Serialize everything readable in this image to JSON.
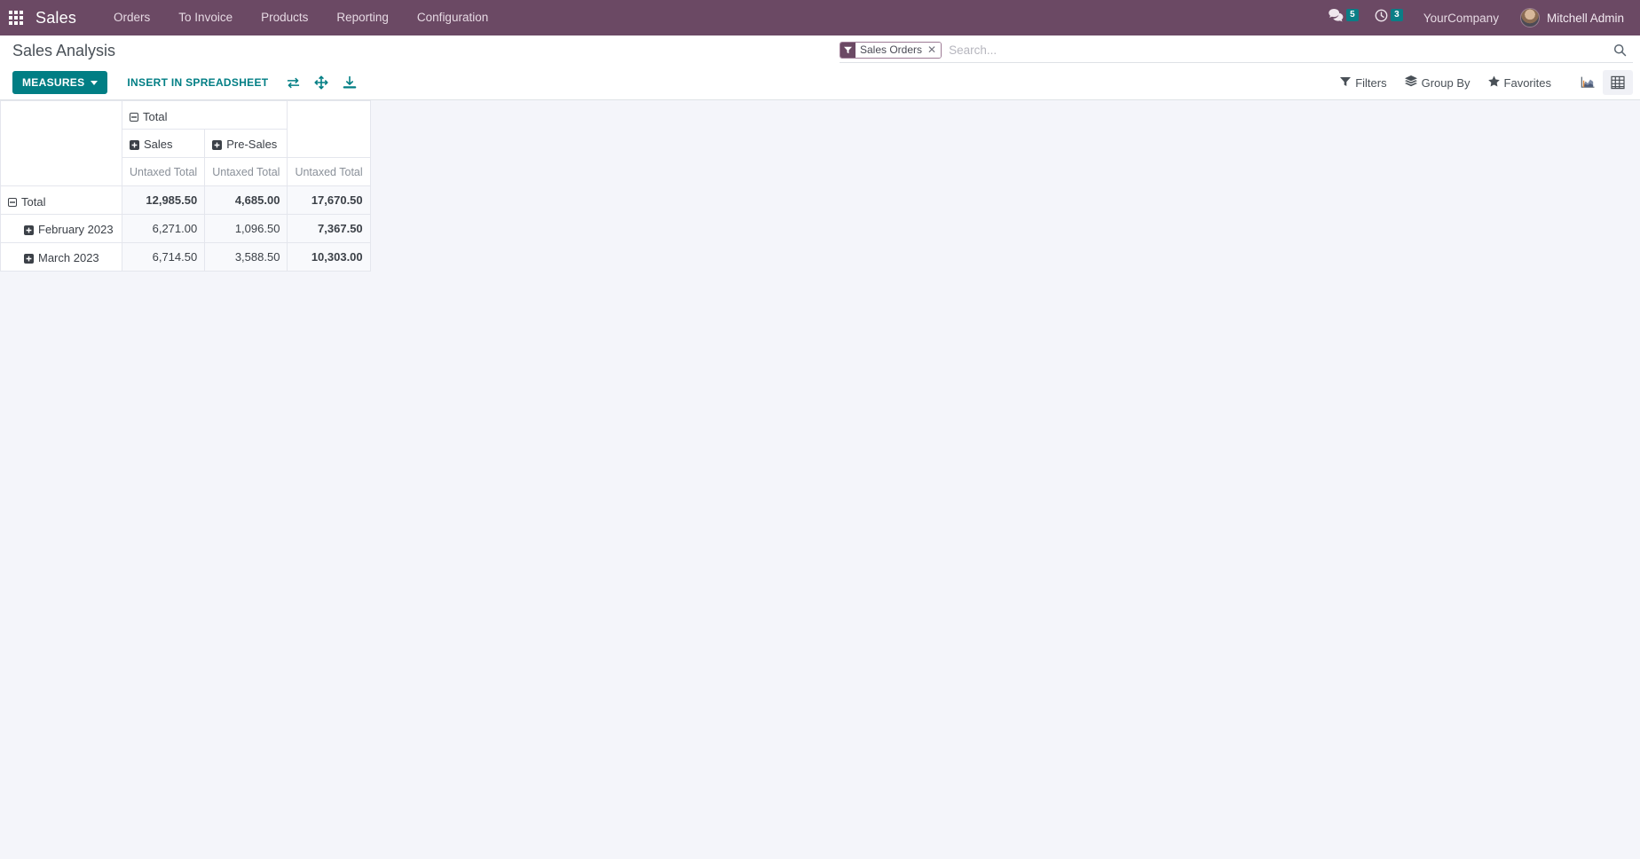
{
  "navbar": {
    "apps_icon": "apps-grid-icon",
    "brand": "Sales",
    "menu": [
      {
        "label": "Orders"
      },
      {
        "label": "To Invoice"
      },
      {
        "label": "Products"
      },
      {
        "label": "Reporting"
      },
      {
        "label": "Configuration"
      }
    ],
    "messages": {
      "icon": "chat-bubble-icon",
      "count": "5"
    },
    "activities": {
      "icon": "clock-icon",
      "count": "3"
    },
    "company": "YourCompany",
    "user": "Mitchell Admin",
    "avatar_icon": "user-avatar"
  },
  "control_panel": {
    "title": "Sales Analysis",
    "search": {
      "facet_icon": "filter-funnel-icon",
      "facet_label": "Sales Orders",
      "facet_remove_icon": "close-icon",
      "placeholder": "Search...",
      "value": "",
      "search_icon": "search-icon"
    },
    "measures_label": "MEASURES",
    "insert_spreadsheet_label": "INSERT IN SPREADSHEET",
    "flip_axis_icon": "flip-axis-icon",
    "expand_all_icon": "expand-all-icon",
    "download_icon": "download-xlsx-icon",
    "filters_label": "Filters",
    "filters_icon": "filter-funnel-icon",
    "group_by_label": "Group By",
    "group_by_icon": "layers-icon",
    "favorites_label": "Favorites",
    "favorites_icon": "star-icon",
    "view_graph_icon": "graph-view-icon",
    "view_pivot_icon": "pivot-view-icon",
    "active_view": "pivot"
  },
  "pivot": {
    "col_group_total": {
      "label": "Total",
      "state": "expanded",
      "icon": "minus-square-icon"
    },
    "col_groups": [
      {
        "label": "Sales",
        "state": "collapsed",
        "icon": "plus-square-icon"
      },
      {
        "label": "Pre-Sales",
        "state": "collapsed",
        "icon": "plus-square-icon"
      }
    ],
    "measure_label": "Untaxed Total",
    "measure_headers": [
      "Untaxed Total",
      "Untaxed Total",
      "Untaxed Total"
    ],
    "rows": [
      {
        "label": "Total",
        "level": 0,
        "state": "expanded",
        "icon": "minus-square-icon",
        "values": [
          "12,985.50",
          "4,685.00",
          "17,670.50"
        ]
      },
      {
        "label": "February 2023",
        "level": 1,
        "state": "collapsed",
        "icon": "plus-square-icon",
        "values": [
          "6,271.00",
          "1,096.50",
          "7,367.50"
        ]
      },
      {
        "label": "March 2023",
        "level": 1,
        "state": "collapsed",
        "icon": "plus-square-icon",
        "values": [
          "6,714.50",
          "3,588.50",
          "10,303.00"
        ]
      }
    ]
  },
  "colors": {
    "navbar_bg": "#6b4964",
    "accent_teal": "#017e84",
    "badge_bg": "#0b7e86",
    "page_bg": "#f4f5fa",
    "value_cell_bg": "#f8f9fc"
  }
}
